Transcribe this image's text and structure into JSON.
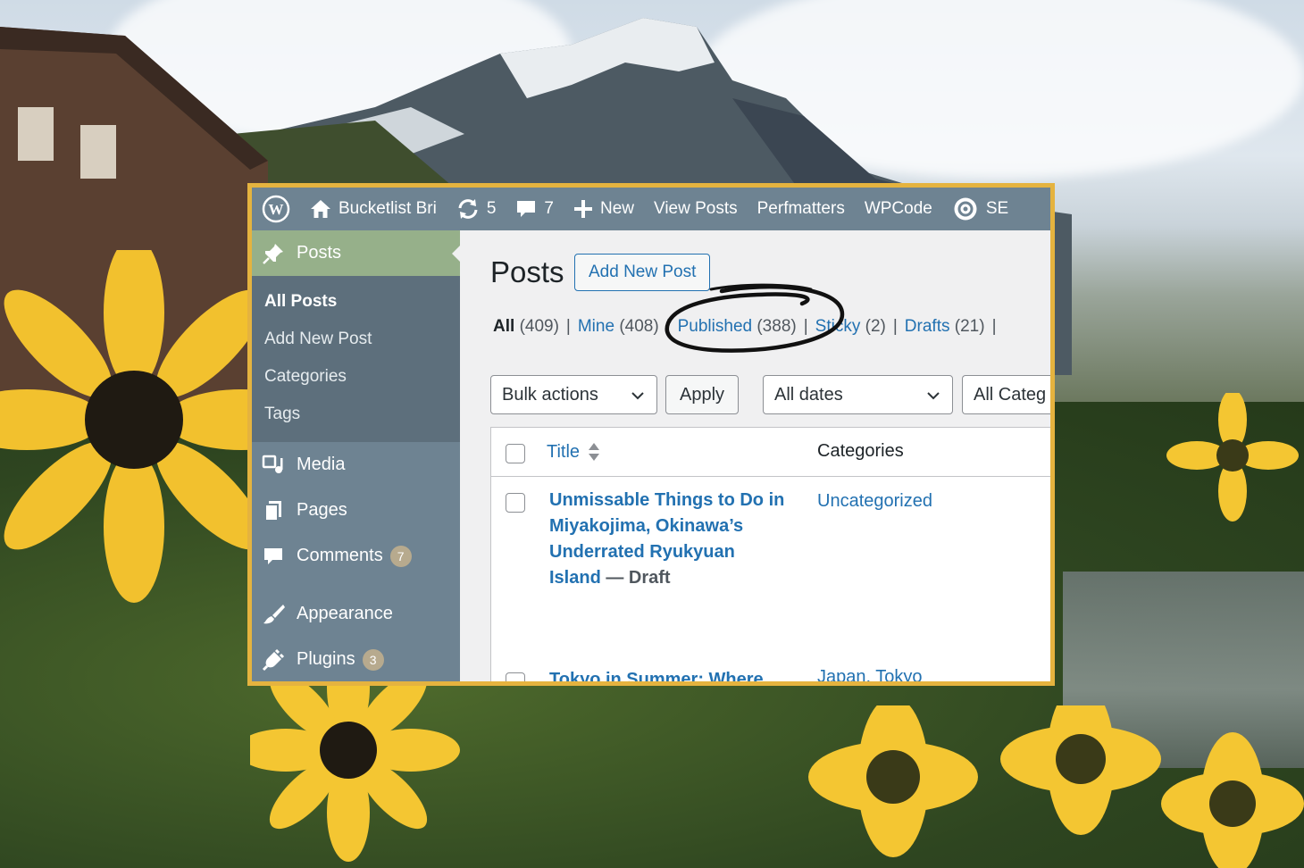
{
  "admin_bar": {
    "site_name": "Bucketlist Bri",
    "updates_count": "5",
    "comments_count": "7",
    "new_label": "New",
    "view_posts_label": "View Posts",
    "perfmatters_label": "Perfmatters",
    "wpcode_label": "WPCode",
    "seo_label": "SE"
  },
  "sidebar": {
    "posts_label": "Posts",
    "submenu": [
      "All Posts",
      "Add New Post",
      "Categories",
      "Tags"
    ],
    "media_label": "Media",
    "pages_label": "Pages",
    "comments_label": "Comments",
    "comments_badge": "7",
    "appearance_label": "Appearance",
    "plugins_label": "Plugins",
    "plugins_badge": "3"
  },
  "main": {
    "page_title": "Posts",
    "add_new_label": "Add New Post",
    "filters": {
      "all_label": "All",
      "all_count": "(409)",
      "mine_label": "Mine",
      "mine_count": "(408)",
      "published_label": "Published",
      "published_count": "(388)",
      "sticky_label": "Sticky",
      "sticky_count": "(2)",
      "drafts_label": "Drafts",
      "drafts_count": "(21)",
      "separator": "|"
    },
    "bulk_actions": "Bulk actions",
    "apply_label": "Apply",
    "dates_filter": "All dates",
    "categories_filter": "All Categ",
    "table": {
      "col_title": "Title",
      "col_categories": "Categories",
      "rows": [
        {
          "title": "Unmissable Things to Do in Miyakojima, Okinawa’s Underrated Ryukyuan Island",
          "state": " — Draft",
          "category": "Uncategorized"
        },
        {
          "title": "Tokyo in Summer: Where",
          "state": "",
          "category": "Japan, Tokyo"
        }
      ]
    }
  },
  "colors": {
    "frame_border": "#e5b33f",
    "admin_bar": "#6e8392",
    "active_menu": "#96b08a",
    "link": "#2271b1"
  }
}
